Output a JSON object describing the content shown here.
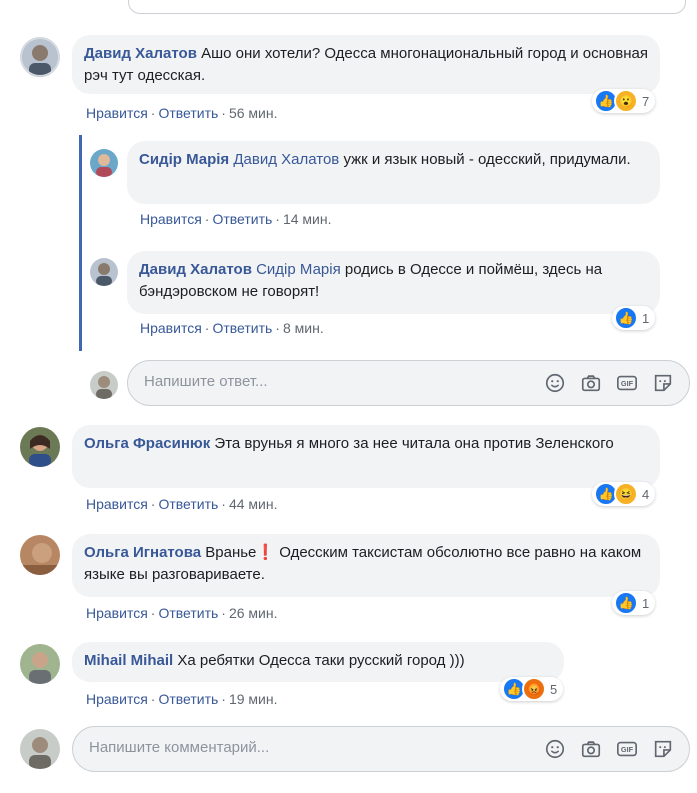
{
  "comments": [
    {
      "author": "Давид Халатов",
      "mention": "",
      "text": "Ашо они хотели? Одесса многонациональный город и основная рэч тут одесская.",
      "like": "Нравится",
      "reply": "Ответить",
      "time": "56 мин.",
      "reactions": [
        "like",
        "wow"
      ],
      "count": "7"
    },
    {
      "author": "Сидір Марія",
      "mention": "Давид Халатов",
      "text": "ужк и язык новый - одесский, придумали.",
      "like": "Нравится",
      "reply": "Ответить",
      "time": "14 мин."
    },
    {
      "author": "Давид Халатов",
      "mention": "Сидір Марія",
      "text": "родись в Одессе и поймёш, здесь на бэндэровском не говорят!",
      "like": "Нравится",
      "reply": "Ответить",
      "time": "8 мин.",
      "reactions": [
        "like"
      ],
      "count": "1"
    },
    {
      "author": "Ольга Фрасинюк",
      "mention": "",
      "text": "Эта врунья я много за нее читала она против Зеленского",
      "like": "Нравится",
      "reply": "Ответить",
      "time": "44 мин.",
      "reactions": [
        "like",
        "haha"
      ],
      "count": "4"
    },
    {
      "author": "Ольга Игнатова",
      "mention": "",
      "text": "Вранье❗ Одесским таксистам обсолютно все равно на каком языке вы разговариваете.",
      "like": "Нравится",
      "reply": "Ответить",
      "time": "26 мин.",
      "reactions": [
        "like"
      ],
      "count": "1"
    },
    {
      "author": "Mihail Mihail",
      "mention": "",
      "text": "Ха ребятки Одесса таки русский город )))",
      "like": "Нравится",
      "reply": "Ответить",
      "time": "19 мин.",
      "reactions": [
        "like",
        "angry"
      ],
      "count": "5"
    }
  ],
  "reply_input": {
    "placeholder": "Напишите ответ..."
  },
  "comment_input": {
    "placeholder": "Напишите комментарий..."
  },
  "icons": [
    "emoji-icon",
    "camera-icon",
    "gif-icon",
    "sticker-icon"
  ],
  "colors": {
    "link": "#385898",
    "like": "#1877f2",
    "thread": "#4267b2",
    "bubble": "#f2f3f5"
  }
}
